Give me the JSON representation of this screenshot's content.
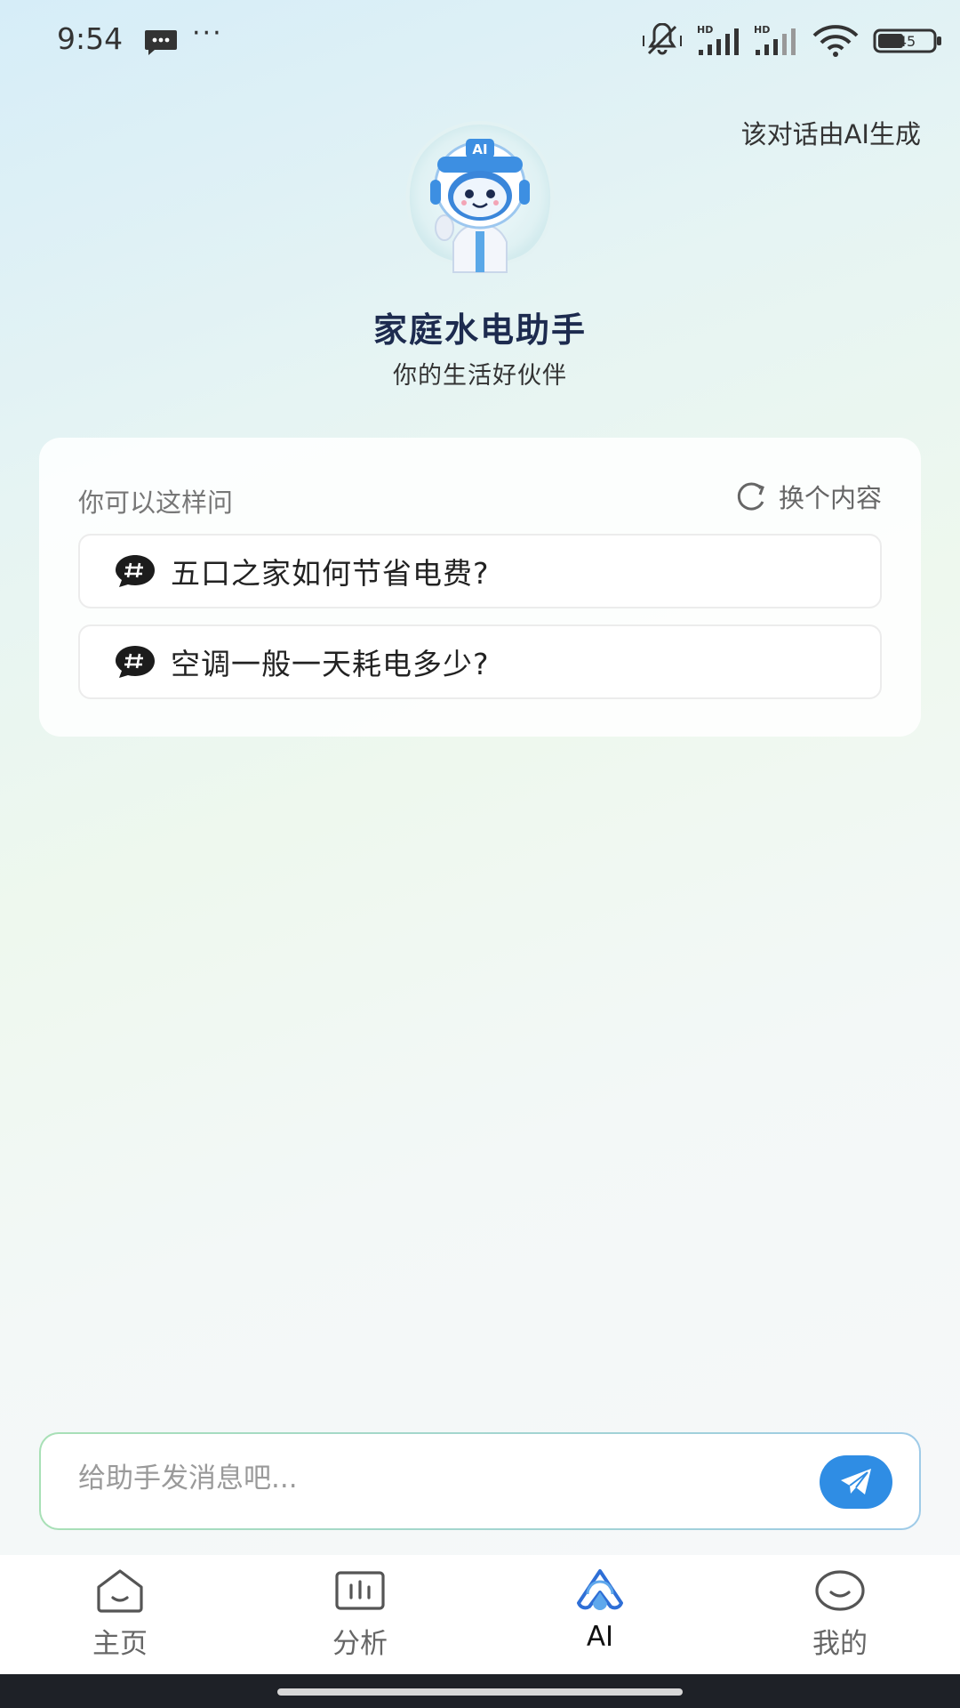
{
  "status_bar": {
    "time": "9:54",
    "more": "···",
    "battery": "45",
    "icons": [
      "message-icon",
      "mute-icon",
      "hd-signal-icon",
      "hd-signal-icon",
      "wifi-icon",
      "battery-icon"
    ]
  },
  "header": {
    "ai_note": "该对话由AI生成",
    "title": "家庭水电助手",
    "subtitle": "你的生活好伙伴",
    "avatar_badge": "AI"
  },
  "suggestions": {
    "heading": "你可以这样问",
    "refresh_label": "换个内容",
    "items": [
      {
        "text": "五口之家如何节省电费?"
      },
      {
        "text": "空调一般一天耗电多少?"
      }
    ]
  },
  "composer": {
    "placeholder": "给助手发消息吧...",
    "send_color": "#2f8de4"
  },
  "tabs": [
    {
      "label": "主页",
      "icon": "home-icon"
    },
    {
      "label": "分析",
      "icon": "chart-icon"
    },
    {
      "label": "AI",
      "icon": "ai-logo-icon",
      "active": true
    },
    {
      "label": "我的",
      "icon": "profile-icon"
    }
  ],
  "colors": {
    "accent": "#2f8de4",
    "title": "#1d2b4f"
  }
}
